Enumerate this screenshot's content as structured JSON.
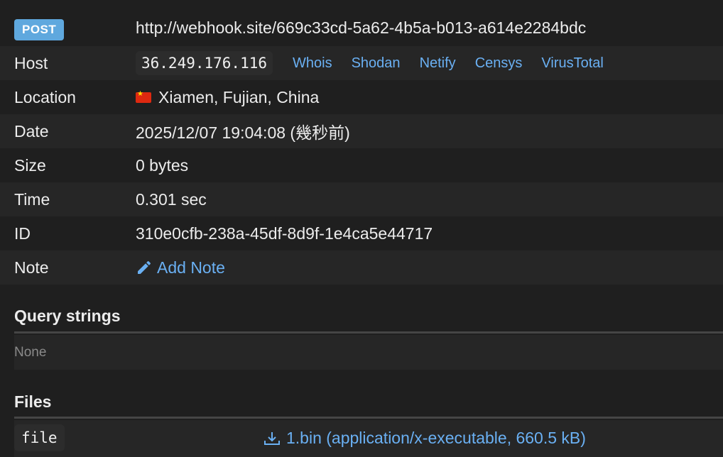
{
  "request": {
    "method": "POST",
    "url": "http://webhook.site/669c33cd-5a62-4b5a-b013-a614e2284bdc"
  },
  "details": {
    "host": {
      "label": "Host",
      "ip": "36.249.176.116",
      "links": [
        "Whois",
        "Shodan",
        "Netify",
        "Censys",
        "VirusTotal"
      ]
    },
    "location": {
      "label": "Location",
      "value": "Xiamen, Fujian, China",
      "flag_icon": "china-flag-icon"
    },
    "date": {
      "label": "Date",
      "value": "2025/12/07 19:04:08 (幾秒前)"
    },
    "size": {
      "label": "Size",
      "value": "0 bytes"
    },
    "time": {
      "label": "Time",
      "value": "0.301 sec"
    },
    "id": {
      "label": "ID",
      "value": "310e0cfb-238a-45df-8d9f-1e4ca5e44717"
    },
    "note": {
      "label": "Note",
      "action": "Add Note",
      "icon": "pencil-icon"
    }
  },
  "query_strings": {
    "title": "Query strings",
    "empty_text": "None"
  },
  "files": {
    "title": "Files",
    "items": [
      {
        "key": "file",
        "link_text": "1.bin (application/x-executable, 660.5 kB)",
        "icon": "download-icon"
      }
    ]
  },
  "colors": {
    "background": "#1f1f1f",
    "stripe": "#262626",
    "link": "#6ab0f3",
    "badge": "#5fa8de"
  }
}
